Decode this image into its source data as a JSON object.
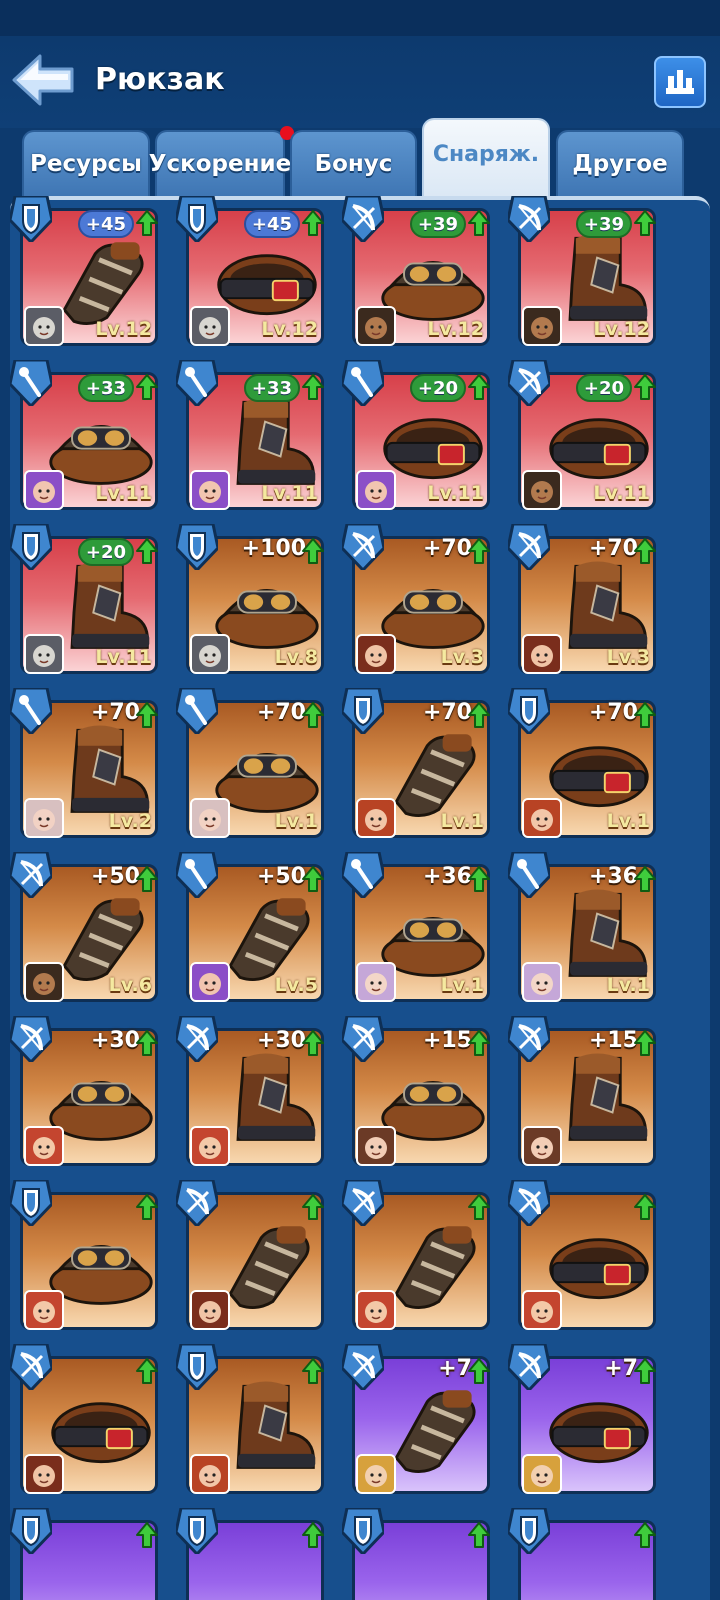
{
  "header": {
    "title": "Рюкзак"
  },
  "tabs": [
    {
      "label": "Ресурсы",
      "active": false
    },
    {
      "label": "Ускорение",
      "active": false,
      "notification": true
    },
    {
      "label": "Бонус",
      "active": false
    },
    {
      "label": "Снаряж.",
      "active": true
    },
    {
      "label": "Другое",
      "active": false
    }
  ],
  "colors": {
    "background": "#0d3a6e",
    "panel": "#174f8d",
    "rarity_red": "#d7404a",
    "rarity_orange": "#d48a48",
    "rarity_purple": "#9a64ec",
    "bonus_green": "#2e9b3a",
    "bonus_blue": "#4c79d6",
    "level_text": "#f5e9a0"
  },
  "items": [
    {
      "slot": "shield",
      "item": "gauntlet",
      "rarity": "red",
      "bonus": "+45",
      "bonus_style": "blue",
      "level": "Lv.12",
      "avatar": "knight"
    },
    {
      "slot": "shield",
      "item": "belt",
      "rarity": "red",
      "bonus": "+45",
      "bonus_style": "blue",
      "level": "Lv.12",
      "avatar": "knight"
    },
    {
      "slot": "bow",
      "item": "goggles",
      "rarity": "red",
      "bonus": "+39",
      "bonus_style": "green",
      "level": "Lv.12",
      "avatar": "bearded"
    },
    {
      "slot": "bow",
      "item": "boot",
      "rarity": "red",
      "bonus": "+39",
      "bonus_style": "green",
      "level": "Lv.12",
      "avatar": "bearded"
    },
    {
      "slot": "staff",
      "item": "goggles",
      "rarity": "red",
      "bonus": "+33",
      "bonus_style": "green",
      "level": "Lv.11",
      "avatar": "purple-hair"
    },
    {
      "slot": "staff",
      "item": "boot",
      "rarity": "red",
      "bonus": "+33",
      "bonus_style": "green",
      "level": "Lv.11",
      "avatar": "purple-hair"
    },
    {
      "slot": "staff",
      "item": "belt",
      "rarity": "red",
      "bonus": "+20",
      "bonus_style": "green",
      "level": "Lv.11",
      "avatar": "purple-hair"
    },
    {
      "slot": "bow",
      "item": "belt",
      "rarity": "red",
      "bonus": "+20",
      "bonus_style": "green",
      "level": "Lv.11",
      "avatar": "bearded"
    },
    {
      "slot": "shield",
      "item": "boot",
      "rarity": "red",
      "bonus": "+20",
      "bonus_style": "green",
      "level": "Lv.11",
      "avatar": "knight"
    },
    {
      "slot": "shield",
      "item": "goggles",
      "rarity": "orange",
      "bonus": "+100",
      "bonus_style": "plain",
      "level": "Lv.8",
      "avatar": "knight"
    },
    {
      "slot": "bow",
      "item": "goggles",
      "rarity": "orange",
      "bonus": "+70",
      "bonus_style": "plain",
      "level": "Lv.3",
      "avatar": "pirate"
    },
    {
      "slot": "bow",
      "item": "boot",
      "rarity": "orange",
      "bonus": "+70",
      "bonus_style": "plain",
      "level": "Lv.3",
      "avatar": "pirate"
    },
    {
      "slot": "staff",
      "item": "boot",
      "rarity": "orange",
      "bonus": "+70",
      "bonus_style": "plain",
      "level": "Lv.2",
      "avatar": "elder"
    },
    {
      "slot": "staff",
      "item": "goggles",
      "rarity": "orange",
      "bonus": "+70",
      "bonus_style": "plain",
      "level": "Lv.1",
      "avatar": "elder"
    },
    {
      "slot": "shield",
      "item": "gauntlet",
      "rarity": "orange",
      "bonus": "+70",
      "bonus_style": "plain",
      "level": "Lv.1",
      "avatar": "red-hair"
    },
    {
      "slot": "shield",
      "item": "belt",
      "rarity": "orange",
      "bonus": "+70",
      "bonus_style": "plain",
      "level": "Lv.1",
      "avatar": "red-hair"
    },
    {
      "slot": "bow",
      "item": "gauntlet",
      "rarity": "orange",
      "bonus": "+50",
      "bonus_style": "plain",
      "level": "Lv.6",
      "avatar": "bearded"
    },
    {
      "slot": "staff",
      "item": "gauntlet",
      "rarity": "orange",
      "bonus": "+50",
      "bonus_style": "plain",
      "level": "Lv.5",
      "avatar": "purple-hair"
    },
    {
      "slot": "staff",
      "item": "goggles",
      "rarity": "orange",
      "bonus": "+36",
      "bonus_style": "plain",
      "level": "Lv.1",
      "avatar": "viking"
    },
    {
      "slot": "staff",
      "item": "boot",
      "rarity": "orange",
      "bonus": "+36",
      "bonus_style": "plain",
      "level": "Lv.1",
      "avatar": "viking"
    },
    {
      "slot": "bow",
      "item": "goggles",
      "rarity": "orange",
      "bonus": "+30",
      "bonus_style": "plain",
      "level": "",
      "avatar": "warrior-girl"
    },
    {
      "slot": "bow",
      "item": "boot",
      "rarity": "orange",
      "bonus": "+30",
      "bonus_style": "plain",
      "level": "",
      "avatar": "warrior-girl"
    },
    {
      "slot": "bow",
      "item": "goggles",
      "rarity": "orange",
      "bonus": "+15",
      "bonus_style": "plain",
      "level": "",
      "avatar": "brown-hair"
    },
    {
      "slot": "bow",
      "item": "boot",
      "rarity": "orange",
      "bonus": "+15",
      "bonus_style": "plain",
      "level": "",
      "avatar": "brown-hair"
    },
    {
      "slot": "shield",
      "item": "goggles",
      "rarity": "orange",
      "bonus": "",
      "bonus_style": "plain",
      "level": "",
      "avatar": "warrior-girl"
    },
    {
      "slot": "bow",
      "item": "gauntlet",
      "rarity": "orange",
      "bonus": "",
      "bonus_style": "plain",
      "level": "",
      "avatar": "pirate"
    },
    {
      "slot": "bow",
      "item": "gauntlet",
      "rarity": "orange",
      "bonus": "",
      "bonus_style": "plain",
      "level": "",
      "avatar": "warrior-girl"
    },
    {
      "slot": "bow",
      "item": "belt",
      "rarity": "orange",
      "bonus": "",
      "bonus_style": "plain",
      "level": "",
      "avatar": "warrior-girl"
    },
    {
      "slot": "bow",
      "item": "belt",
      "rarity": "orange",
      "bonus": "",
      "bonus_style": "plain",
      "level": "",
      "avatar": "pirate"
    },
    {
      "slot": "shield",
      "item": "boot",
      "rarity": "orange",
      "bonus": "",
      "bonus_style": "plain",
      "level": "",
      "avatar": "red-hair"
    },
    {
      "slot": "bow",
      "item": "gauntlet",
      "rarity": "purple",
      "bonus": "+7",
      "bonus_style": "plain",
      "level": "",
      "avatar": "blonde"
    },
    {
      "slot": "bow",
      "item": "belt",
      "rarity": "purple",
      "bonus": "+7",
      "bonus_style": "plain",
      "level": "",
      "avatar": "blonde"
    },
    {
      "slot": "shield",
      "item": "",
      "rarity": "purple",
      "bonus": "",
      "bonus_style": "plain",
      "level": "",
      "avatar": ""
    },
    {
      "slot": "shield",
      "item": "",
      "rarity": "purple",
      "bonus": "",
      "bonus_style": "plain",
      "level": "",
      "avatar": ""
    },
    {
      "slot": "shield",
      "item": "",
      "rarity": "purple",
      "bonus": "",
      "bonus_style": "plain",
      "level": "",
      "avatar": ""
    },
    {
      "slot": "shield",
      "item": "",
      "rarity": "purple",
      "bonus": "",
      "bonus_style": "plain",
      "level": "",
      "avatar": ""
    }
  ]
}
